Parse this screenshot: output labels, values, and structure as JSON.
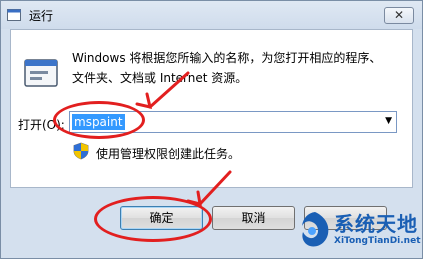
{
  "window": {
    "title": "运行",
    "close_label": "✕"
  },
  "description": {
    "line1": "Windows 将根据您所输入的名称，为您打开相应的程序、",
    "line2": "文件夹、文档或 Internet 资源。"
  },
  "open_field": {
    "label": "打开(O):",
    "value": "mspaint"
  },
  "admin_note": "使用管理权限创建此任务。",
  "buttons": {
    "ok": "确定",
    "cancel": "取消",
    "browse": ""
  },
  "logo": {
    "name_cn": "系统天地",
    "url": "XiTongTianDi.net"
  },
  "colors": {
    "annotation": "#e21f1f",
    "selection": "#3399ff",
    "logo": "#1a5fb4"
  }
}
